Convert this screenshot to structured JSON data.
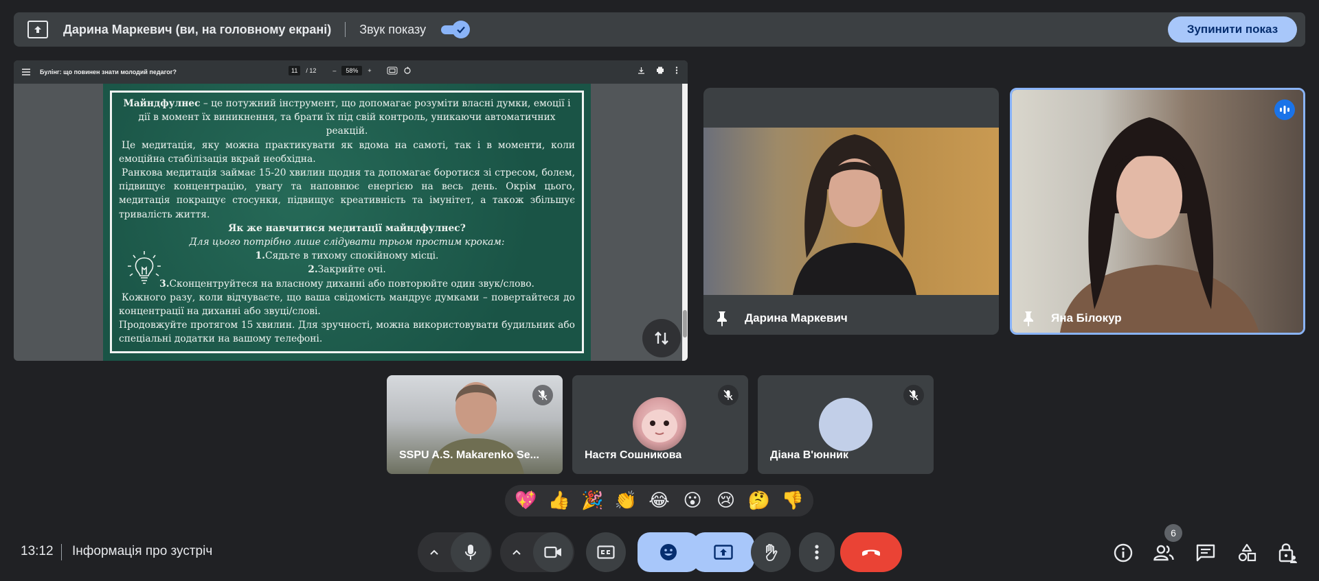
{
  "topbar": {
    "presenter_text": "Дарина Маркевич (ви, на головному екрані)",
    "sound_label": "Звук показу",
    "stop_label": "Зупинити показ"
  },
  "pdf": {
    "title": "Булінг: що повинен знати молодий педагог?",
    "page_current": "11",
    "page_total": "/ 12",
    "zoom": "58%",
    "slide": {
      "p1_bold": "Майндфулнес",
      "p1_rest": " – це потужний інструмент, що допомагає розуміти власні думки, емоції і дії в момент їх виникнення, та брати їх під свій контроль, уникаючи автоматичних реакцій.",
      "p2": "Це медитація, яку можна практикувати як вдома на самоті, так і в моменти, коли емоційна стабілізація вкрай необхідна.",
      "p3": "Ранкова медитація займає 15-20 хвилин щодня та допомагає боротися зі стресом, болем, підвищує концентрацію, увагу та наповнює енергією на весь день. Окрім цього, медитація покращує стосунки, підвищує креативність та імунітет, а також збільшує тривалість життя.",
      "heading": "Як же навчитися медитації майндфулнес?",
      "subheading": "Для цього потрібно лише слідувати трьом простим крокам:",
      "step1_num": "1.",
      "step1": "Сядьте в тихому спокійному місці.",
      "step2_num": "2.",
      "step2": "Закрийте очі.",
      "step3_num": "3.",
      "step3": "Сконцентруйтеся на власному диханні або повторюйте один звук/слово.",
      "p4": "Кожного разу, коли відчуваєте, що ваша свідомість мандрує думками – повертайтеся до концентрації на диханні або звуці/слові.",
      "p5": "Продовжуйте протягом 15 хвилин. Для зручності, можна використовувати будильник або спеціальні додатки на вашому телефоні."
    }
  },
  "participants": {
    "darina": "Дарина Маркевич",
    "yana": "Яна Білокур",
    "small": [
      {
        "name": "SSPU A.S. Makarenko Se..."
      },
      {
        "name": "Настя Сошникова"
      },
      {
        "name": "Діана В'юнник"
      }
    ]
  },
  "reactions": [
    "💖",
    "👍",
    "🎉",
    "👏",
    "😂",
    "😮",
    "😢",
    "🤔",
    "👎"
  ],
  "bottom": {
    "clock": "13:12",
    "meeting_info": "Інформація про зустріч",
    "people_count": "6"
  },
  "colors": {
    "background": "#202124",
    "accent": "#8ab4f8",
    "end_call": "#ea4335",
    "active_button": "#a8c7fa"
  }
}
